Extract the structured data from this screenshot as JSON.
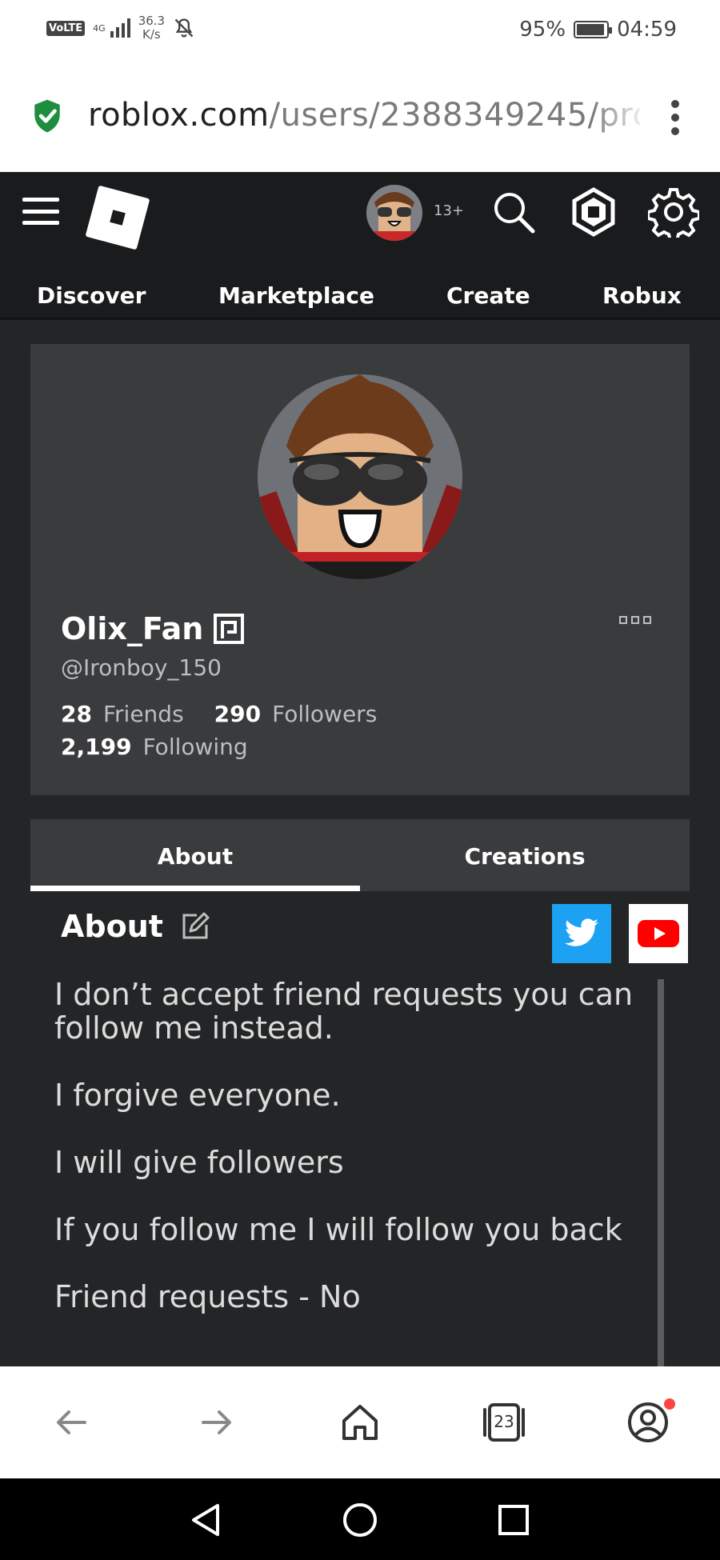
{
  "status_bar": {
    "volte": "VoLTE",
    "network_type": "4G",
    "speed_value": "36.3",
    "speed_unit": "K/s",
    "battery_percent": "95%",
    "time": "04:59",
    "battery_level": 0.95
  },
  "browser": {
    "url_domain": "roblox.com",
    "url_path": "/users/2388349245/pro",
    "open_tabs": "23"
  },
  "header": {
    "age_badge": "13+",
    "nav": [
      "Discover",
      "Marketplace",
      "Create",
      "Robux"
    ]
  },
  "profile": {
    "display_name": "Olix_Fan",
    "username": "@Ironboy_150",
    "friends_count": "28",
    "friends_label": "Friends",
    "followers_count": "290",
    "followers_label": "Followers",
    "following_count": "2,199",
    "following_label": "Following"
  },
  "tabs": [
    "About",
    "Creations"
  ],
  "about": {
    "title": "About",
    "paragraphs": [
      "I don’t accept friend requests you can follow me instead.",
      "I forgive everyone.",
      "I will give followers",
      "If you follow me I will follow you back",
      "Friend requests - No"
    ]
  },
  "colors": {
    "page_bg": "#232527",
    "header_bg": "#191b1d",
    "card_bg": "#393b3d",
    "twitter": "#1da1f2",
    "youtube": "#ff0000",
    "shield_green": "#1e8e3e"
  }
}
